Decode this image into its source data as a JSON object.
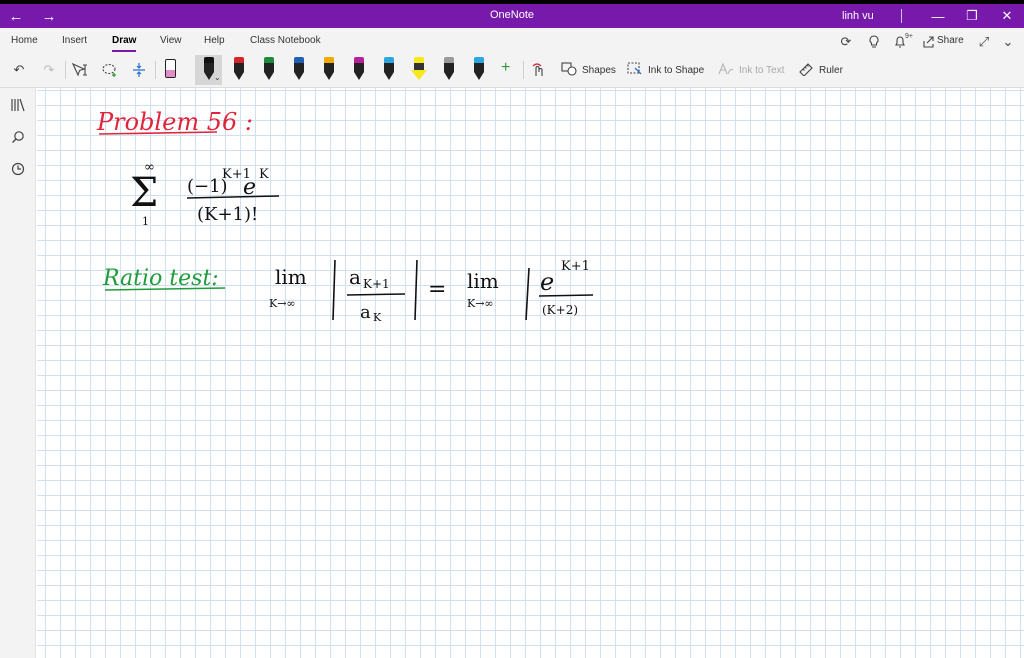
{
  "titlebar": {
    "title": "OneNote",
    "user": "linh vu",
    "back_icon": "arrow-left-icon",
    "forward_icon": "arrow-right-icon"
  },
  "ribbon": {
    "tabs": [
      {
        "label": "Home"
      },
      {
        "label": "Insert"
      },
      {
        "label": "Draw"
      },
      {
        "label": "View"
      },
      {
        "label": "Help"
      },
      {
        "label": "Class Notebook"
      }
    ],
    "active_tab": "Draw",
    "share_label": "Share",
    "notification_count": "9+",
    "shapes_label": "Shapes",
    "ink_to_shape_label": "Ink to Shape",
    "ink_to_text_label": "Ink to Text",
    "ruler_label": "Ruler",
    "pen_colors": [
      "#e73d90",
      "#111111",
      "#d5252b",
      "#1f8a3c",
      "#1f5fb4",
      "#f2a900",
      "#b8219d",
      "#2aa6e0",
      "#f7e81b",
      "#9a9a9a",
      "#2aa6e0"
    ]
  },
  "note": {
    "problem_heading": "Problem 56 :",
    "sum_upper": "∞",
    "sum_lower": "1",
    "numerator": "(−1)",
    "numerator_exp": "K+1",
    "numerator_e": "e",
    "numerator_e_exp": "K",
    "denominator": "(K+1)!",
    "ratio_heading": "Ratio test:",
    "lim_1": "lim",
    "lim_1_sub": "K→∞",
    "ratio_num": "a",
    "ratio_num_sub": "K+1",
    "ratio_den": "a",
    "ratio_den_sub": "K",
    "equals": "=",
    "lim_2": "lim",
    "lim_2_sub": "K→∞",
    "rhs_num": "e",
    "rhs_num_exp": "K+1",
    "rhs_den": "(K+2)"
  }
}
